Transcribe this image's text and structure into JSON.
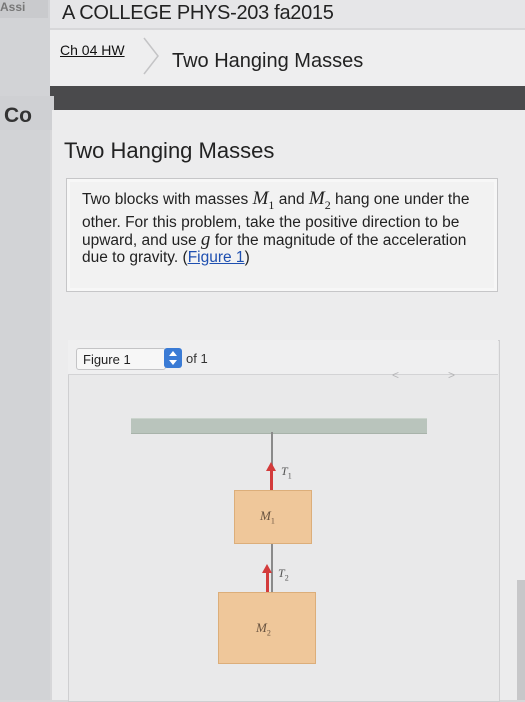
{
  "header": {
    "left_tab": "Assi",
    "course_title": "A COLLEGE PHYS-203 fa2015"
  },
  "breadcrumb": {
    "assignment": "Ch 04 HW",
    "current": "Two Hanging Masses"
  },
  "sidebar": {
    "label": "Co"
  },
  "problem": {
    "title": "Two Hanging Masses",
    "text_1": "Two blocks with masses ",
    "m1": "M",
    "m1_sub": "1",
    "text_2": " and ",
    "m2": "M",
    "m2_sub": "2",
    "text_3": " hang one under the other. For this problem, take the positive direction to be upward, and use ",
    "g": "g",
    "text_4": " for the magnitude of the acceleration due to gravity. ",
    "paren_open": "(",
    "figure_link": "Figure 1",
    "paren_close": ")"
  },
  "figure": {
    "selector_value": "Figure 1",
    "of_text": "of 1",
    "prev_label": "<",
    "next_label": ">",
    "labels": {
      "t1": "T",
      "t1_sub": "1",
      "t2": "T",
      "t2_sub": "2",
      "m1": "M",
      "m1_sub": "1",
      "m2": "M",
      "m2_sub": "2"
    }
  },
  "colors": {
    "link": "#1e4fb0",
    "arrow": "#d33b3b",
    "block": "#efc79a",
    "ceiling": "#b9c4bc",
    "stepper": "#3a7bd5"
  }
}
